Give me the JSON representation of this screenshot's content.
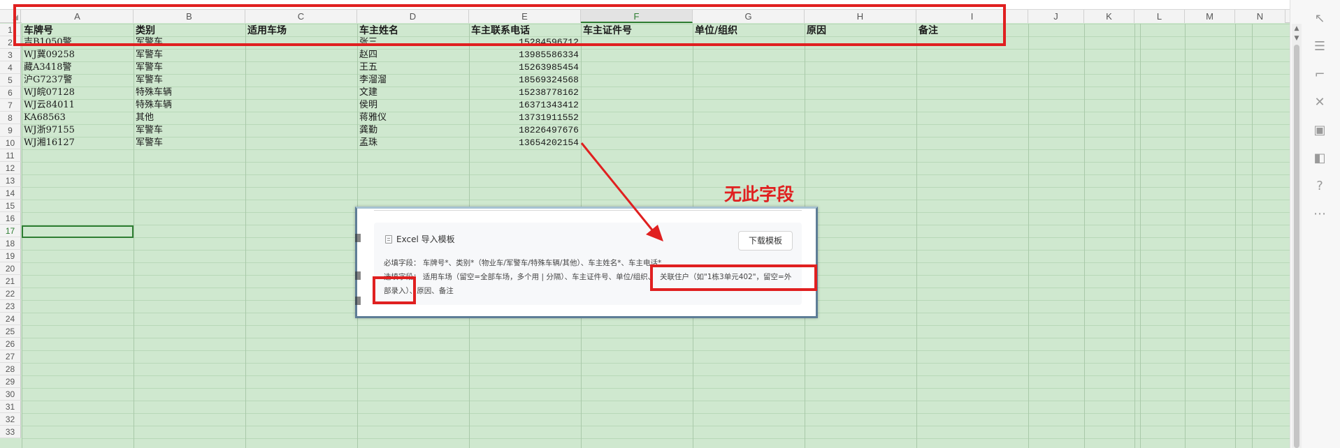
{
  "columns": [
    "A",
    "B",
    "C",
    "D",
    "E",
    "F",
    "G",
    "H",
    "I",
    "J",
    "K",
    "L",
    "M",
    "N"
  ],
  "selected_column": "F",
  "rows": [
    1,
    2,
    3,
    4,
    5,
    6,
    7,
    8,
    9,
    10,
    11,
    12,
    13,
    14,
    15,
    16,
    17,
    18,
    19,
    20,
    21,
    22,
    23,
    24,
    25,
    26,
    27,
    28,
    29,
    30,
    31,
    32,
    33
  ],
  "selected_row": 17,
  "header_row": [
    "车牌号",
    "类别",
    "适用车场",
    "车主姓名",
    "车主联系电话",
    "车主证件号",
    "单位/组织",
    "原因",
    "备注"
  ],
  "data_rows": [
    {
      "plate": "吉B1050警",
      "type": "军警车",
      "name": "张三",
      "phone": "15284596712"
    },
    {
      "plate": "WJ冀09258",
      "type": "军警车",
      "name": "赵四",
      "phone": "13985586334"
    },
    {
      "plate": "藏A3418警",
      "type": "军警车",
      "name": "王五",
      "phone": "15263985454"
    },
    {
      "plate": "沪G7237警",
      "type": "军警车",
      "name": "李溜溜",
      "phone": "18569324568"
    },
    {
      "plate": "WJ皖07128",
      "type": "特殊车辆",
      "name": "文建",
      "phone": "15238778162"
    },
    {
      "plate": "WJ云84011",
      "type": "特殊车辆",
      "name": "侯明",
      "phone": "16371343412"
    },
    {
      "plate": "KA68563",
      "type": "其他",
      "name": "蒋雅仪",
      "phone": "13731911552"
    },
    {
      "plate": "WJ浙97155",
      "type": "军警车",
      "name": "龚勤",
      "phone": "18226497676"
    },
    {
      "plate": "WJ湘16127",
      "type": "军警车",
      "name": "孟珠",
      "phone": "13654202154"
    }
  ],
  "dialog": {
    "title": "Excel 导入模板",
    "download_button": "下载模板",
    "required_line": "必填字段：  车牌号*、类别*（物业车/军警车/特殊车辆/其他）、车主姓名*、车主电话*",
    "optional_line": "选填字段：  适用车场（留空=全部车场，多个用 | 分隔）、车主证件号、单位/组织、",
    "linked_household": "关联住户（如\"1栋3单元402\"，留空=外",
    "line3": "部录入）、原因、备注"
  },
  "annotation": {
    "label": "无此字段",
    "color": "#e02020"
  },
  "toolbar_icons": [
    "pointer-icon",
    "sliders-icon",
    "crop-icon",
    "tools-icon",
    "image-icon",
    "gallery-icon",
    "help-icon",
    "more-icon"
  ]
}
